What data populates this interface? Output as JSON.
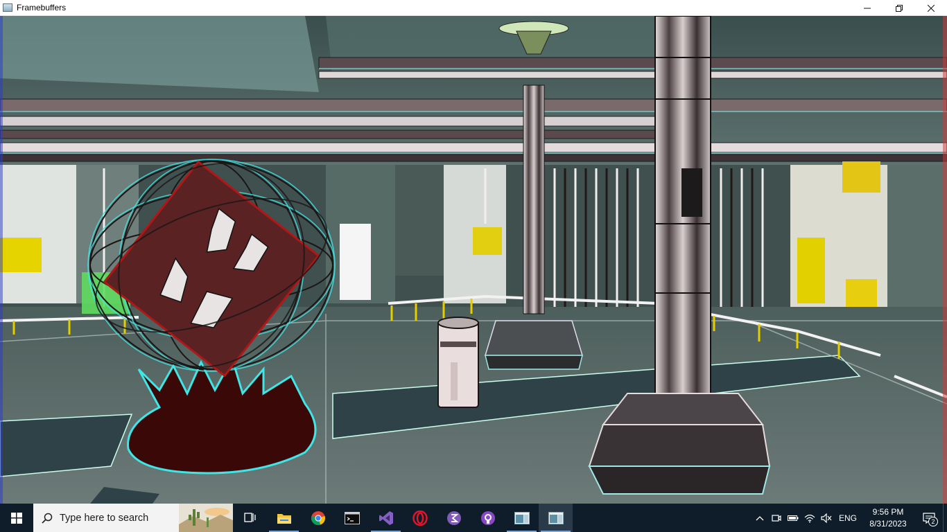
{
  "window": {
    "title": "Framebuffers",
    "minimize_icon": "minimize-icon",
    "restore_icon": "restore-icon",
    "close_icon": "close-icon"
  },
  "viewport": {
    "scene": "3d-render-sci-fi-hangar-edge-detection"
  },
  "taskbar": {
    "search_placeholder": "Type here to search",
    "apps": [
      {
        "icon": "task-view-icon"
      },
      {
        "icon": "file-explorer-icon"
      },
      {
        "icon": "chrome-icon"
      },
      {
        "icon": "terminal-icon"
      },
      {
        "icon": "visual-studio-icon"
      },
      {
        "icon": "opera-icon"
      },
      {
        "icon": "emacs-icon"
      },
      {
        "icon": "github-desktop-icon"
      },
      {
        "icon": "app-window-icon"
      },
      {
        "icon": "app-window-active-icon"
      }
    ],
    "tray": {
      "language": "ENG",
      "time": "9:56 PM",
      "date": "8/31/2023",
      "notification_count": "2"
    }
  },
  "colors": {
    "taskbar_bg": "#0f1d2a",
    "accent": "#7aa7d6",
    "cube": "#5a2222",
    "blob": "#3b0808",
    "glow": "#3ee6e6"
  }
}
